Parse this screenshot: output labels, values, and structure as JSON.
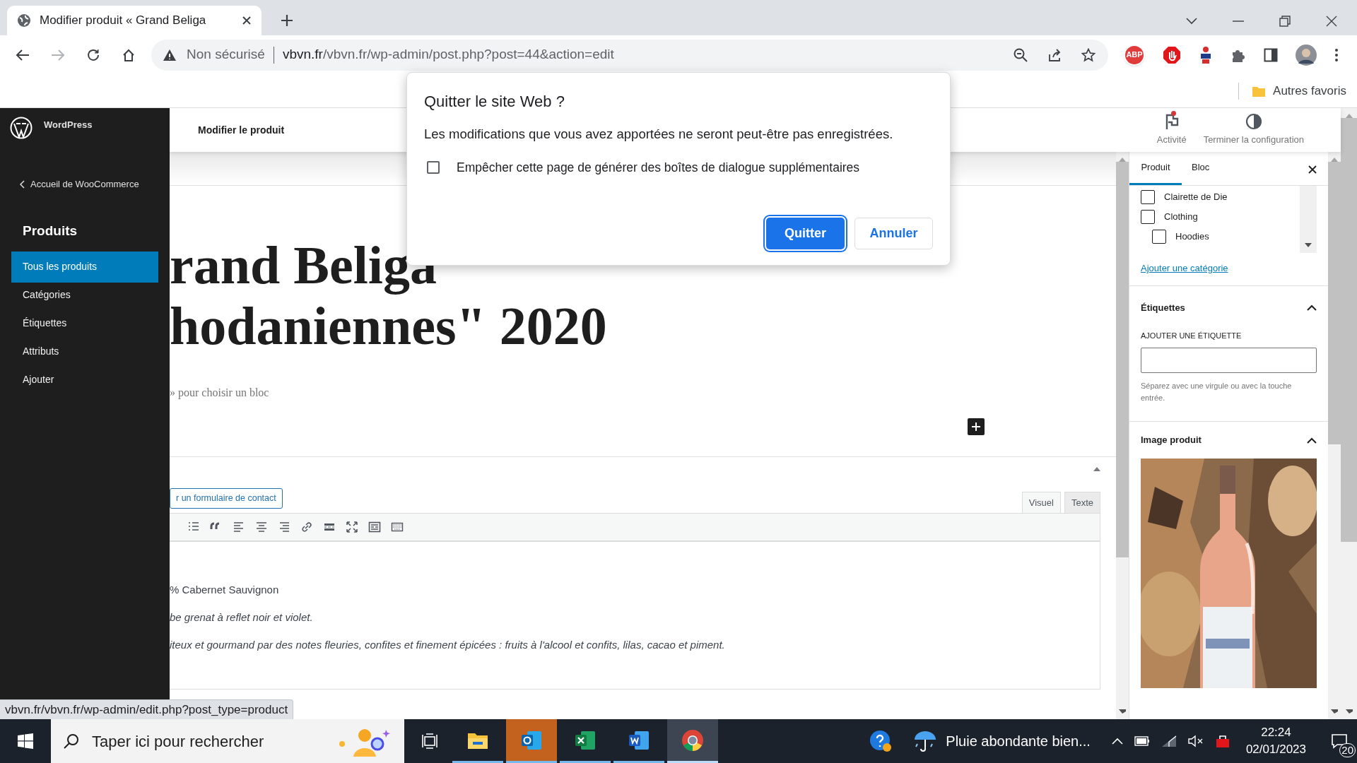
{
  "browser": {
    "tab": {
      "title": "Modifier produit « Grand Beliga"
    },
    "address": {
      "security": "Non sécurisé",
      "host": "vbvn.fr",
      "path": "/vbvn.fr/wp-admin/post.php?post=44&action=edit"
    },
    "extensions": [
      {
        "kind": "abp",
        "label": "ABP"
      },
      {
        "kind": "hand"
      },
      {
        "kind": "tool"
      },
      {
        "kind": "puzzle"
      },
      {
        "kind": "sidepanel"
      }
    ],
    "bookmarks": [
      "Autres favoris"
    ]
  },
  "wp_sidebar": {
    "brand": "WordPress",
    "back": "Accueil de WooCommerce",
    "section": "Produits",
    "items": [
      {
        "label": "Tous les produits",
        "selected": true
      },
      {
        "label": "Catégories",
        "selected": false
      },
      {
        "label": "Étiquettes",
        "selected": false
      },
      {
        "label": "Attributs",
        "selected": false
      },
      {
        "label": "Ajouter",
        "selected": false
      }
    ]
  },
  "header": {
    "title": "Modifier le produit",
    "actions": [
      {
        "kind": "flag",
        "label": "Activité",
        "notification": true
      },
      {
        "kind": "progress",
        "label": "Terminer la configuration",
        "notification": false
      }
    ]
  },
  "editor": {
    "title_lines": [
      "rand Beliga",
      "hodaniennes\" 2020"
    ],
    "hint": "» pour choisir un bloc"
  },
  "classic_editor": {
    "form_button": "r un formulaire de contact",
    "tabs": [
      {
        "label": "Visuel",
        "selected": true
      },
      {
        "label": "Texte",
        "selected": false
      }
    ],
    "lines": [
      {
        "text": "% Cabernet Sauvignon",
        "italic": false
      },
      {
        "text": "be grenat à reflet noir et violet.",
        "italic": true
      },
      {
        "text": "iteux et gourmand par des notes fleuries, confites et finement épicées : fruits à l'alcool et confits, lilas, cacao et piment.",
        "italic": true
      }
    ]
  },
  "settings_panel": {
    "tabs": [
      {
        "label": "Produit",
        "selected": true
      },
      {
        "label": "Bloc",
        "selected": false
      }
    ],
    "categories": [
      {
        "label": "Clairette de Die",
        "checked": false
      },
      {
        "label": "Clothing",
        "checked": false,
        "children": [
          {
            "label": "Hoodies",
            "checked": false
          }
        ]
      }
    ],
    "add_category": "Ajouter une catégorie",
    "tags": {
      "title": "Étiquettes",
      "expanded": true,
      "field_label": "AJOUTER UNE ÉTIQUETTE",
      "help": "Séparez avec une virgule ou avec la touche entrée."
    },
    "image": {
      "title": "Image produit",
      "expanded": true,
      "kind": "picture"
    }
  },
  "dialog": {
    "title": "Quitter le site Web ?",
    "message": "Les modifications que vous avez apportées ne seront peut-être pas enregistrées.",
    "checkbox": {
      "label": "Empêcher cette page de générer des boîtes de dialogue supplémentaires",
      "checked": false
    },
    "buttons": [
      {
        "label": "Quitter",
        "kind": "primary"
      },
      {
        "label": "Annuler",
        "kind": "secondary"
      }
    ]
  },
  "status_url": "vbvn.fr/vbvn.fr/wp-admin/edit.php?post_type=product",
  "taskbar": {
    "search_placeholder": "Taper ici pour rechercher",
    "apps": [
      {
        "kind": "explorer",
        "selected": false,
        "attention": false
      },
      {
        "kind": "outlook",
        "selected": false,
        "attention": true
      },
      {
        "kind": "excel",
        "selected": false,
        "attention": false
      },
      {
        "kind": "word",
        "selected": false,
        "attention": false
      },
      {
        "kind": "chrome",
        "selected": true,
        "attention": false
      }
    ],
    "weather": "Pluie abondante bien...",
    "time": "22:24",
    "date": "02/01/2023",
    "notifications": "20"
  }
}
